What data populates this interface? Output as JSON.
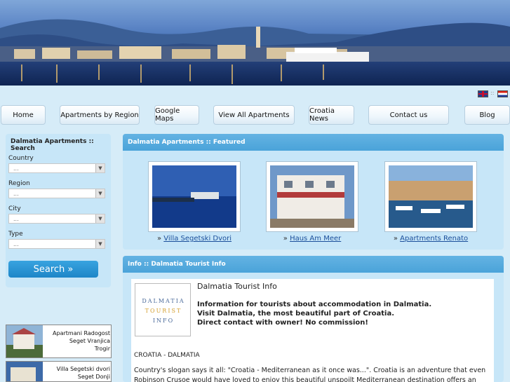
{
  "nav": [
    {
      "label": "Home"
    },
    {
      "label": "Apartments by Region"
    },
    {
      "label": "Google Maps"
    },
    {
      "label": "View All Apartments"
    },
    {
      "label": "Croatia News"
    },
    {
      "label": "Contact us"
    },
    {
      "label": "Blog"
    }
  ],
  "languages": {
    "separator": "::"
  },
  "search": {
    "title": "Dalmatia Apartments :: Search",
    "fields": [
      {
        "label": "Country",
        "value": "..."
      },
      {
        "label": "Region",
        "value": "..."
      },
      {
        "label": "City",
        "value": "..."
      },
      {
        "label": "Type",
        "value": "..."
      }
    ],
    "button_label": "Search »"
  },
  "ads": [
    {
      "line1": "Apartmani Radogost",
      "line2": "Seget Vranjica",
      "line3": "Trogir"
    },
    {
      "line1": "Villa Segetski dvori",
      "line2": "Seget Donji",
      "line3": ""
    }
  ],
  "featured": {
    "title": "Dalmatia Apartments :: Featured",
    "bullet": "»",
    "items": [
      {
        "name": "Villa Segetski Dvori"
      },
      {
        "name": "Haus Am Meer"
      },
      {
        "name": "Apartments Renato"
      }
    ]
  },
  "info": {
    "header": "Info :: Dalmatia Tourist Info",
    "logo": {
      "line1": "DALMATIA",
      "line2": "TOURIST",
      "line3": "INFO"
    },
    "title": "Dalmatia Tourist Info",
    "bold_lines": [
      "Information for tourists about accommodation in Dalmatia.",
      "Visit Dalmatia, the most beautiful part of Croatia.",
      "Direct contact with owner! No commission!"
    ],
    "section": "CROATIA - DALMATIA",
    "body": "Country's slogan says it all: \"Croatia - Mediterranean as it once was...\". Croatia is an adventure that even Robinson Crusoe would have loved to enjoy this beautiful unspoilt Mediterranean destination offers an"
  },
  "colors": {
    "page_bg": "#d6ecf8",
    "panel_bg": "#c7e6f8",
    "panel_header": "#4aa3d9",
    "link": "#1a4e9a",
    "search_button": "#1e86c8"
  }
}
